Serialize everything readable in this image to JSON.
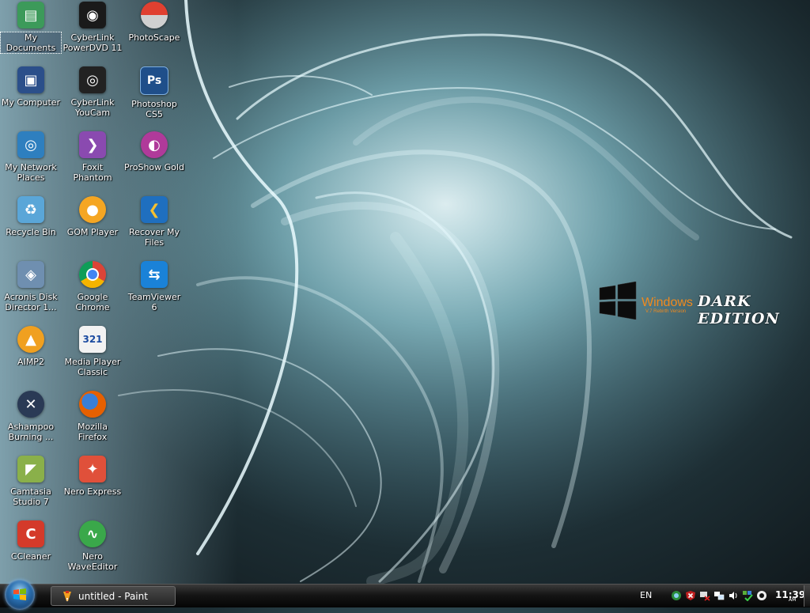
{
  "desktop": {
    "icons": [
      {
        "label": "My\nDocuments",
        "icon": "folder-documents-icon",
        "color": "#3c9a5a"
      },
      {
        "label": "My Computer",
        "icon": "computer-icon",
        "color": "#2b4f8a"
      },
      {
        "label": "My Network\nPlaces",
        "icon": "network-icon",
        "color": "#2e7fbf"
      },
      {
        "label": "Recycle Bin",
        "icon": "recycle-bin-icon",
        "color": "#5aa6d8"
      },
      {
        "label": "Acronis Disk\nDirector 1...",
        "icon": "acronis-icon",
        "color": "#6f8fb0"
      },
      {
        "label": "AIMP2",
        "icon": "aimp-icon",
        "color": "#f0a020"
      },
      {
        "label": "Ashampoo\nBurning ...",
        "icon": "ashampoo-icon",
        "color": "#2a3a55"
      },
      {
        "label": "Camtasia\nStudio 7",
        "icon": "camtasia-icon",
        "color": "#8ab04a"
      },
      {
        "label": "CCleaner",
        "icon": "ccleaner-icon",
        "color": "#d43a2a"
      },
      {
        "label": "CyberLink\nPowerDVD 11",
        "icon": "powerdvd-icon",
        "color": "#1a1a1a"
      },
      {
        "label": "CyberLink\nYouCam",
        "icon": "youcam-icon",
        "color": "#222222"
      },
      {
        "label": "Foxit Phantom",
        "icon": "foxit-icon",
        "color": "#8a4ab0"
      },
      {
        "label": "GOM Player",
        "icon": "gom-player-icon",
        "color": "#f5a623"
      },
      {
        "label": "Google\nChrome",
        "icon": "chrome-icon",
        "color": "#db4437"
      },
      {
        "label": "Media Player\nClassic",
        "icon": "media-player-classic-icon",
        "color": "#f2f2f2"
      },
      {
        "label": "Mozilla\nFirefox",
        "icon": "firefox-icon",
        "color": "#e66000"
      },
      {
        "label": "Nero Express",
        "icon": "nero-express-icon",
        "color": "#e0503a"
      },
      {
        "label": "Nero\nWaveEditor",
        "icon": "nero-waveeditor-icon",
        "color": "#3aa84a"
      },
      {
        "label": "PhotoScape",
        "icon": "photoscape-icon",
        "color": "#d0d0d0"
      },
      {
        "label": "Photoshop\nCS5",
        "icon": "photoshop-icon",
        "color": "#1f4f8a"
      },
      {
        "label": "ProShow Gold",
        "icon": "proshow-gold-icon",
        "color": "#b03a9a"
      },
      {
        "label": "Recover My\nFiles",
        "icon": "recover-my-files-icon",
        "color": "#1f6fbf"
      },
      {
        "label": "TeamViewer 6",
        "icon": "teamviewer-icon",
        "color": "#1a82d8"
      }
    ]
  },
  "branding": {
    "windows": "Windows",
    "version": "V.7 Rebirth Version",
    "edition": "DARK EDITION"
  },
  "taskbar": {
    "task_label": "untitled - Paint",
    "language": "EN",
    "clock_time": "11:39",
    "clock_ampm": "AM",
    "tray_icons": [
      "network-status-icon",
      "security-alert-icon",
      "connection-icon",
      "monitor-icon",
      "volume-icon",
      "update-icon",
      "webcam-icon"
    ]
  }
}
